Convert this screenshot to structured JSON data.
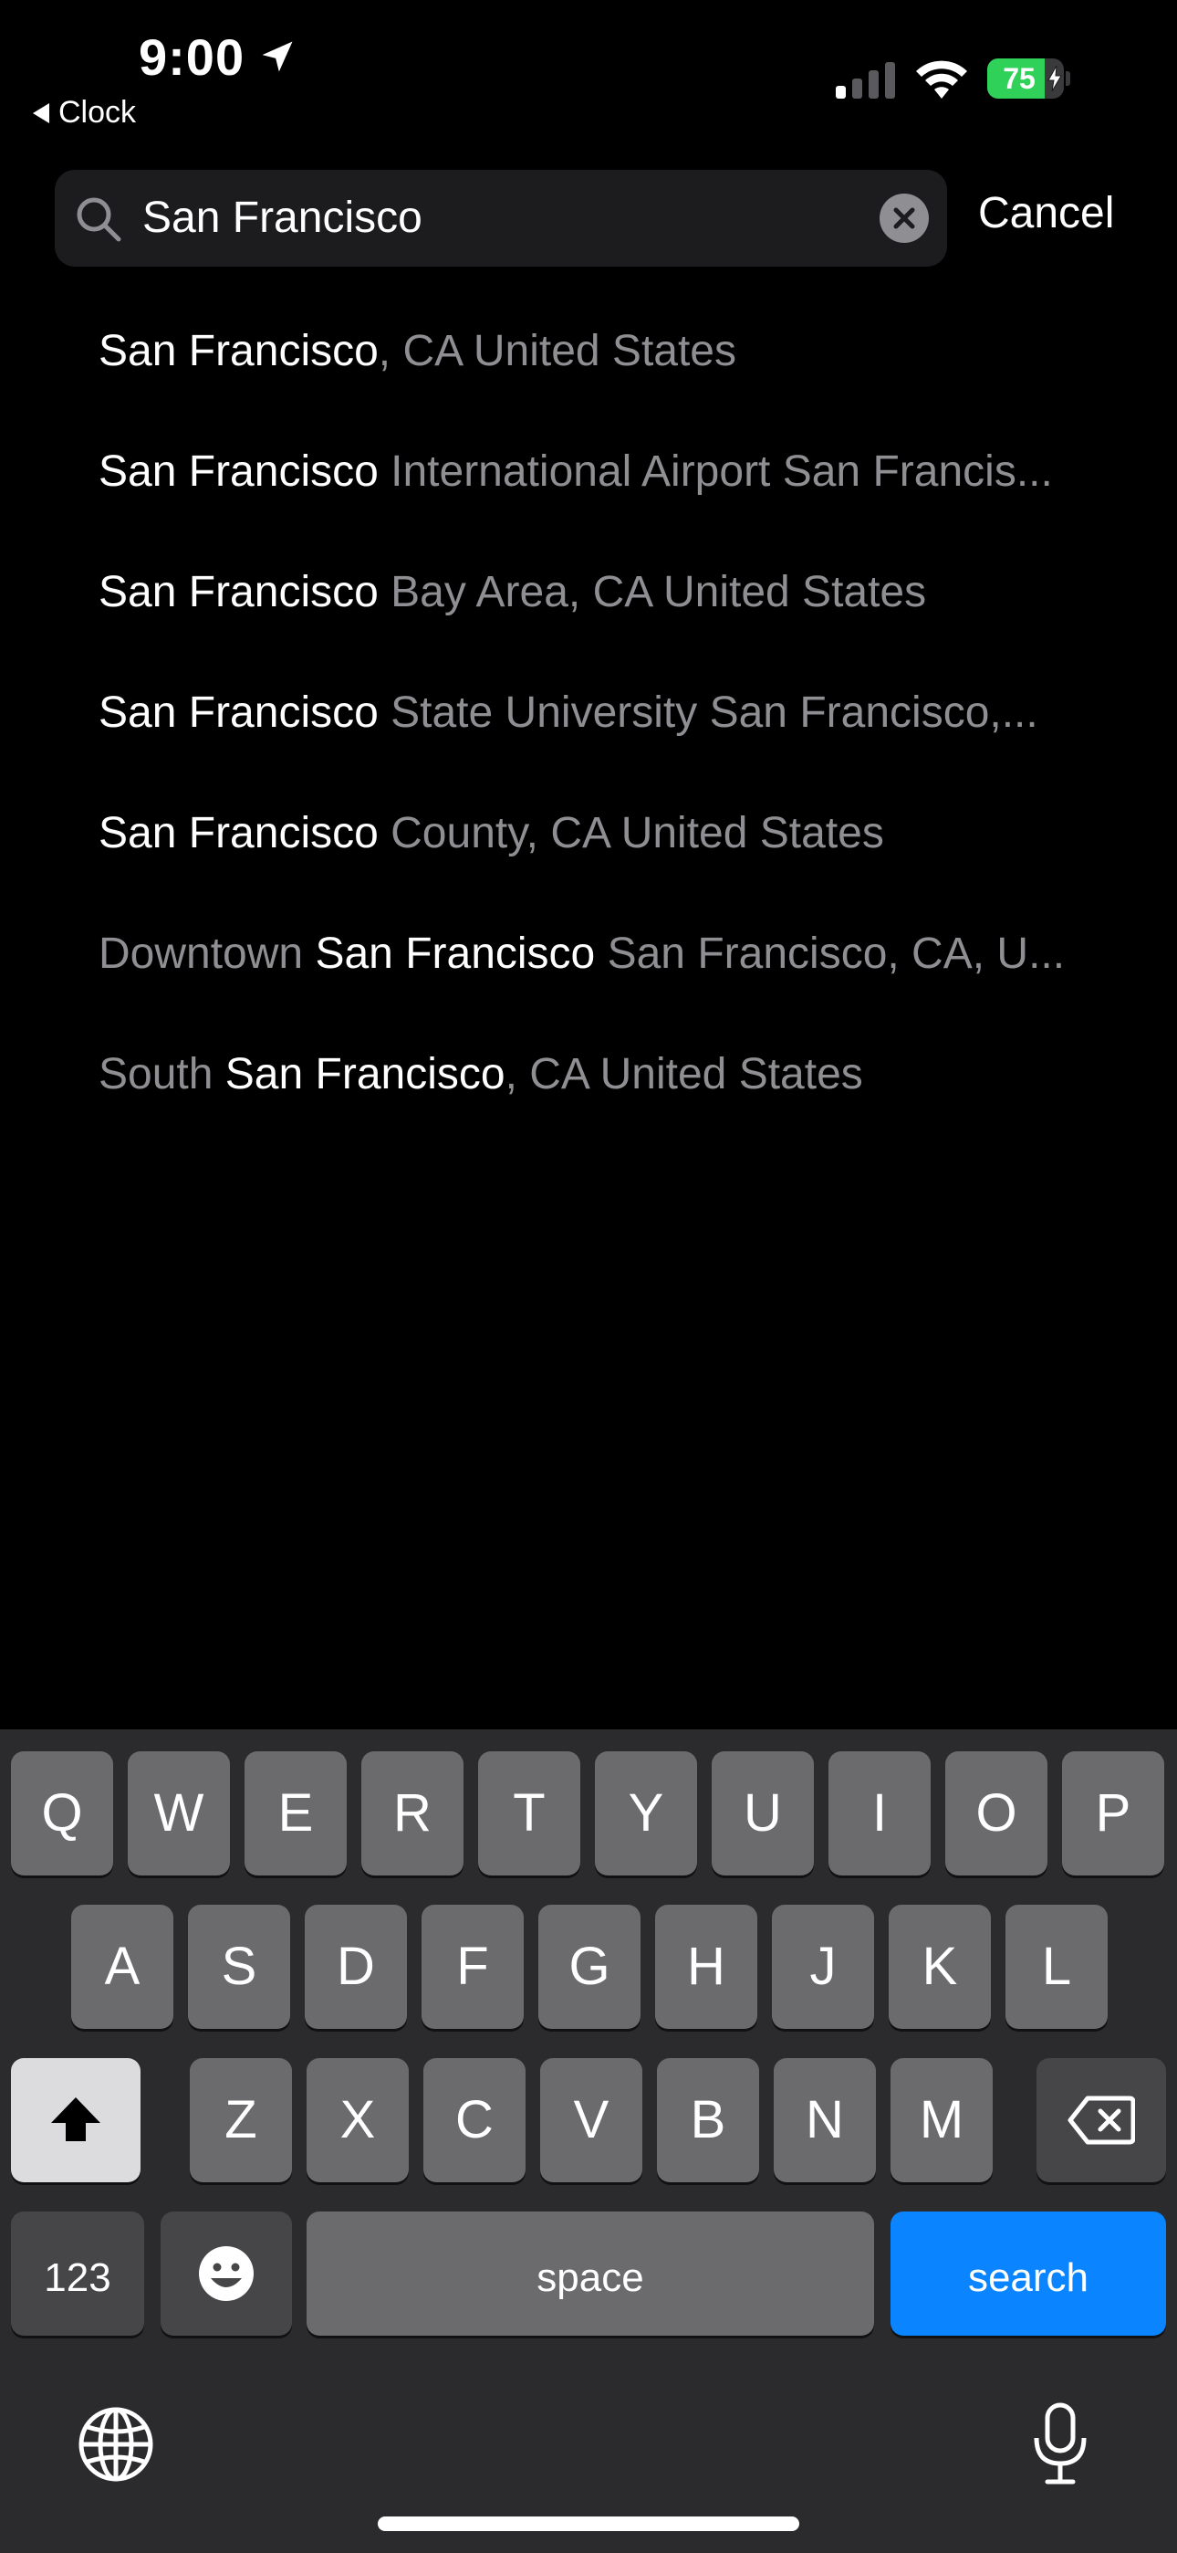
{
  "status_bar": {
    "time": "9:00",
    "back_label": "Clock",
    "battery_percent": "75",
    "battery_level": 0.75,
    "colors": {
      "battery": "#30d158"
    }
  },
  "search": {
    "query": "San Francisco",
    "cancel_label": "Cancel"
  },
  "results": [
    {
      "segments": [
        {
          "text": "San Francisco",
          "style": "w"
        },
        {
          "text": ", CA United States",
          "style": "g"
        }
      ]
    },
    {
      "segments": [
        {
          "text": "San Francisco",
          "style": "w"
        },
        {
          "text": " International Airport San Francis...",
          "style": "g"
        }
      ]
    },
    {
      "segments": [
        {
          "text": "San Francisco",
          "style": "w"
        },
        {
          "text": " Bay Area, CA United States",
          "style": "g"
        }
      ]
    },
    {
      "segments": [
        {
          "text": "San Francisco",
          "style": "w"
        },
        {
          "text": " State University San Francisco,...",
          "style": "g"
        }
      ]
    },
    {
      "segments": [
        {
          "text": "San Francisco",
          "style": "w"
        },
        {
          "text": " County, CA United States",
          "style": "g"
        }
      ]
    },
    {
      "segments": [
        {
          "text": "Downtown ",
          "style": "g"
        },
        {
          "text": "San Francisco",
          "style": "w"
        },
        {
          "text": " San Francisco, CA, U...",
          "style": "g"
        }
      ]
    },
    {
      "segments": [
        {
          "text": "South ",
          "style": "g"
        },
        {
          "text": "San Francisco",
          "style": "w"
        },
        {
          "text": ", CA United States",
          "style": "g"
        }
      ]
    }
  ],
  "keyboard": {
    "row1": [
      "Q",
      "W",
      "E",
      "R",
      "T",
      "Y",
      "U",
      "I",
      "O",
      "P"
    ],
    "row2": [
      "A",
      "S",
      "D",
      "F",
      "G",
      "H",
      "J",
      "K",
      "L"
    ],
    "row3": [
      "Z",
      "X",
      "C",
      "V",
      "B",
      "N",
      "M"
    ],
    "numbers_label": "123",
    "space_label": "space",
    "search_label": "search",
    "colors": {
      "search_key": "#0a84ff"
    }
  }
}
